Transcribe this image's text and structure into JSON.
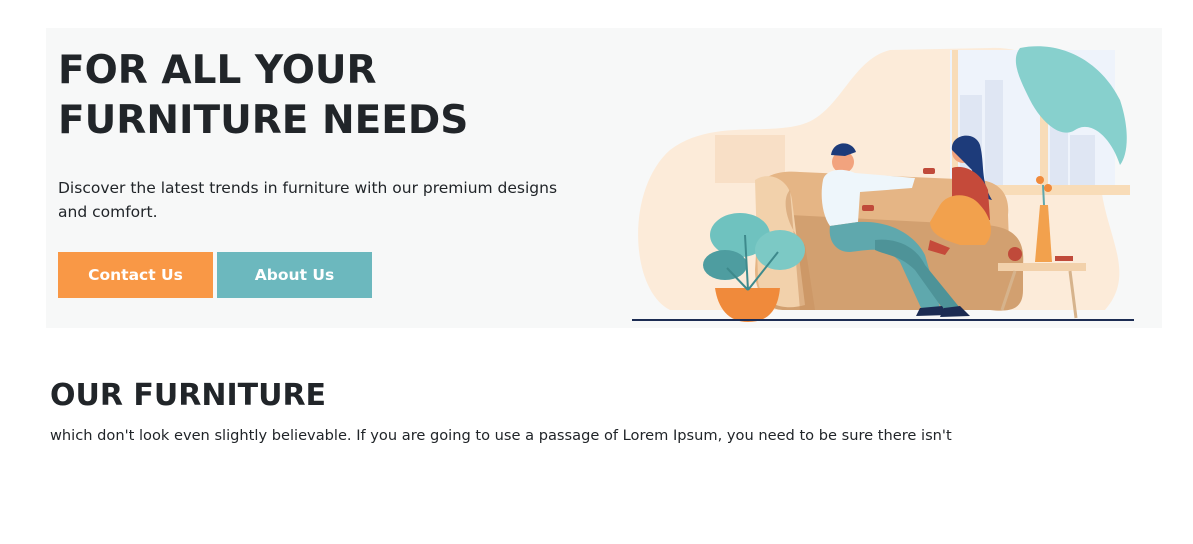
{
  "hero": {
    "title_line1": "FOR ALL YOUR",
    "title_line2": "FURNITURE NEEDS",
    "description": "Discover the latest trends in furniture with our premium designs and comfort.",
    "contact_button": "Contact Us",
    "about_button": "About Us",
    "illustration_icon": "couple-on-sofa-illustration"
  },
  "furniture_section": {
    "title": "OUR FURNITURE",
    "text": "which don't look even slightly believable. If you are going to use a passage of Lorem Ipsum, you need to be sure there isn't"
  },
  "colors": {
    "accent_orange": "#f99846",
    "accent_teal": "#6cb8be",
    "hero_background": "#f7f8f8",
    "heading": "#212529"
  }
}
